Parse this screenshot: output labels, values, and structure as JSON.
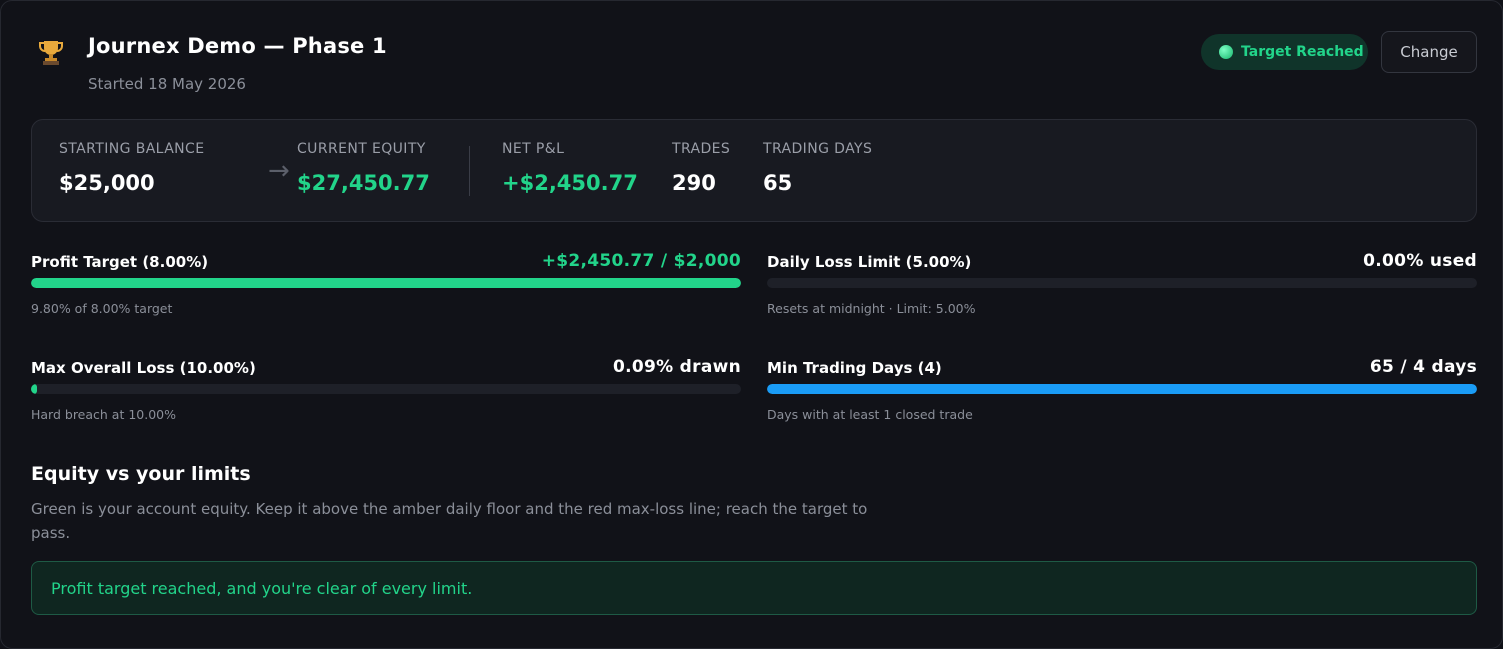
{
  "header": {
    "title": "Journex Demo — Phase 1",
    "subtitle": "Started 18 May 2026",
    "icon": "trophy-icon",
    "status_badge": "Target Reached",
    "change_label": "Change"
  },
  "stats": {
    "starting_balance": {
      "label": "STARTING BALANCE",
      "value": "$25,000"
    },
    "current_equity": {
      "label": "CURRENT EQUITY",
      "value": "$27,450.77"
    },
    "net_pnl": {
      "label": "NET P&L",
      "value": "+$2,450.77"
    },
    "trades": {
      "label": "TRADES",
      "value": "290"
    },
    "trading_days": {
      "label": "TRADING DAYS",
      "value": "65"
    }
  },
  "rules": {
    "profit_target": {
      "name": "Profit Target (8.00%)",
      "value": "+$2,450.77 / $2,000",
      "note": "9.80% of 8.00% target",
      "progress": 1.0
    },
    "daily_loss": {
      "name": "Daily Loss Limit (5.00%)",
      "value": "0.00% used",
      "note": "Resets at midnight · Limit: 5.00%",
      "progress": 0.0
    },
    "max_loss": {
      "name": "Max Overall Loss (10.00%)",
      "value": "0.09% drawn",
      "note": "Hard breach at 10.00%",
      "progress": 0.009
    },
    "min_days": {
      "name": "Min Trading Days (4)",
      "value": "65 / 4 days",
      "note": "Days with at least 1 closed trade",
      "progress": 1.0
    }
  },
  "equity": {
    "title": "Equity vs your limits",
    "description": "Green is your account equity. Keep it above the amber daily floor and the red max-loss line; reach the target to pass.",
    "alert": "Profit target reached, and you're clear of every limit."
  },
  "colors": {
    "accent_green": "#22d48a",
    "accent_blue": "#1a9cf6",
    "background": "#111218"
  }
}
